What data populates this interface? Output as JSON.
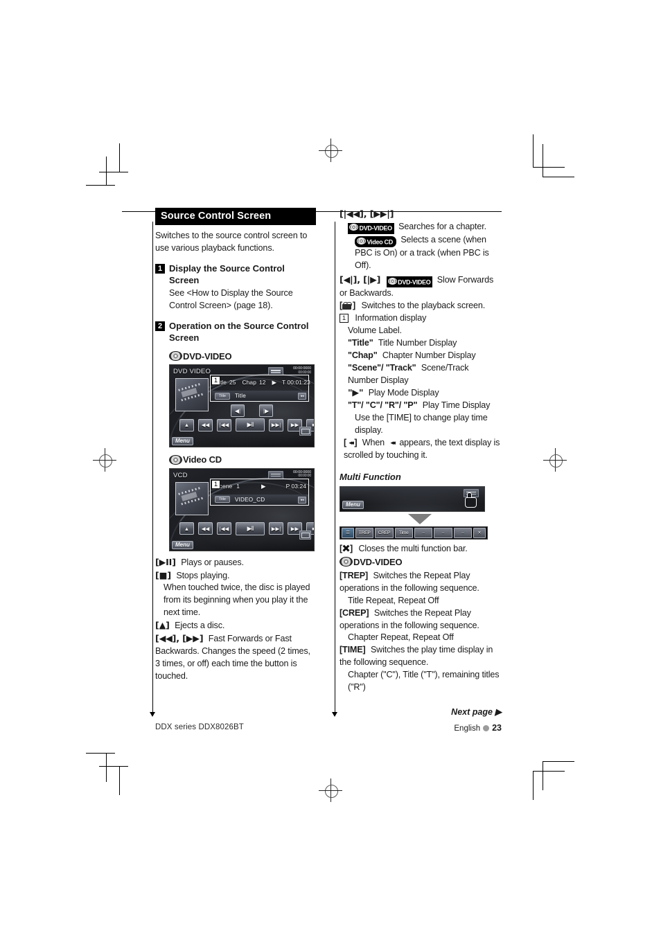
{
  "section": {
    "title": "Source Control Screen",
    "intro": "Switches to the source control screen to use various playback functions.",
    "steps": [
      {
        "num": "1",
        "title": "Display the Source Control Screen",
        "body": "See <How to Display the Source Control Screen> (page 18)."
      },
      {
        "num": "2",
        "title": "Operation on the Source Control Screen",
        "body": ""
      }
    ]
  },
  "badges": {
    "dvd_video": "DVD-VIDEO",
    "video_cd": "Video CD"
  },
  "screens": {
    "dvd": {
      "source_name": "DVD VIDEO",
      "clock_top": "00:00:0000",
      "clock_bottom": "00:00:00",
      "marker": "1",
      "info_title_label": "Title",
      "info_title_value": "25",
      "info_chap_label": "Chap",
      "info_chap_value": "12",
      "info_play_mode": "▶",
      "info_time": "T 00:01:23",
      "tag_button": "Title",
      "text_label": "Title",
      "scroll_button": "◂◂",
      "slow_back": "◀|",
      "slow_fwd": "|▶",
      "btn_eject": "▲",
      "btn_frev": "◀◀",
      "btn_prev": "|◀◀",
      "btn_play": "▶II",
      "btn_next": "▶▶|",
      "btn_ffwd": "▶▶",
      "btn_stop": "■",
      "menu_button": "Menu"
    },
    "vcd": {
      "source_name": "VCD",
      "clock_top": "00:00:0000",
      "clock_bottom": "00:00:00",
      "marker": "1",
      "info_scene_label": "Scene",
      "info_scene_value": "1",
      "info_play_mode": "▶",
      "info_time": "P 03:24",
      "tag_button": "Title",
      "text_label": "VIDEO_CD",
      "scroll_button": "◂◂",
      "btn_eject": "▲",
      "btn_frev": "◀◀",
      "btn_prev": "|◀◀",
      "btn_play": "▶II",
      "btn_next": "▶▶|",
      "btn_ffwd": "▶▶",
      "btn_stop": "■",
      "menu_button": "Menu"
    }
  },
  "left_defs": {
    "playpause_key": "[▶II]",
    "playpause_text": "Plays or pauses.",
    "stop_key": "[■]",
    "stop_text": "Stops playing.",
    "stop_note": "When touched twice, the disc is played from its beginning when you play it the next time.",
    "eject_key": "[▲]",
    "eject_text": "Ejects a disc.",
    "ff_key": "[◀◀], [▶▶]",
    "ff_text": "Fast Forwards or Fast Backwards. Changes the speed (2 times, 3 times, or off) each time the button is touched."
  },
  "right_defs": {
    "search_key": "[|◀◀], [▶▶|]",
    "search_dvd_badge": "DVD-VIDEO",
    "search_dvd_text": "Searches for a chapter.",
    "search_vcd_badge": "Video CD",
    "search_vcd_text": "Selects a scene (when PBC is On) or a track (when PBC is Off).",
    "slow_key": "[◀|], [|▶]",
    "slow_badge": "DVD-VIDEO",
    "slow_text": "Slow Forwards or Backwards.",
    "playback_key_icon": "camera-icon",
    "playback_text": "Switches to the playback screen.",
    "info_num": "1",
    "info_title": "Information display",
    "info_volume": "Volume Label.",
    "info_items": [
      {
        "key": "\"Title\"",
        "text": "Title Number Display"
      },
      {
        "key": "\"Chap\"",
        "text": "Chapter Number Display"
      },
      {
        "key": "\"Scene\"/ \"Track\"",
        "text": "Scene/Track Number Display"
      },
      {
        "key": "\"▶\"",
        "text": "Play Mode Display"
      },
      {
        "key": "\"T\"/ \"C\"/ \"R\"/ \"P\"",
        "text": "Play Time Display"
      }
    ],
    "time_note": "Use the [TIME] to change play time display.",
    "scroll_key": "[ ◂◂ ]",
    "scroll_text_a": "When",
    "scroll_text_b": "appears, the text display is scrolled by touching it."
  },
  "multi_function": {
    "heading": "Multi Function",
    "menu_button": "Menu",
    "bar_cells": [
      "",
      "TREP",
      "CREP",
      "Time",
      "",
      "",
      "",
      ""
    ],
    "close_text": "Closes the multi function bar.",
    "dvd_badge": "DVD-VIDEO",
    "items": [
      {
        "key": "[TREP]",
        "text": "Switches the Repeat Play operations in the following sequence.",
        "detail": "Title Repeat, Repeat Off"
      },
      {
        "key": "[CREP]",
        "text": "Switches the Repeat Play operations in the following sequence.",
        "detail": "Chapter Repeat, Repeat Off"
      },
      {
        "key": "[TIME]",
        "text": "Switches the play time display in the following sequence.",
        "detail": "Chapter (\"C\"), Title (\"T\"), remaining titles (\"R\")"
      }
    ]
  },
  "footer": {
    "model": "DDX series   DDX8026BT",
    "next_page": "Next page ▶",
    "language": "English",
    "page_number": "23"
  }
}
